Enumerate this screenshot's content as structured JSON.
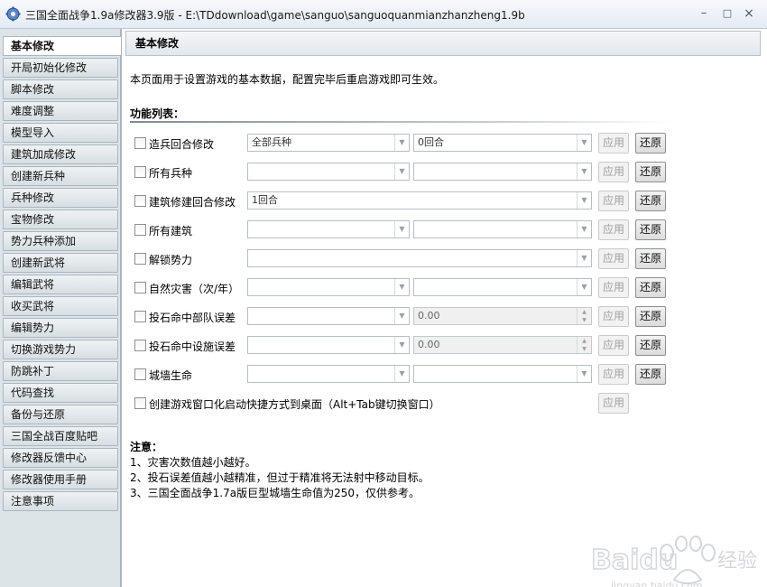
{
  "window": {
    "title": "三国全面战争1.9a修改器3.9版 - E:\\TDdownload\\game\\sanguo\\sanguoquanmianzhanzheng1.9b",
    "minimize": "–",
    "maximize": "□",
    "close": "×"
  },
  "sidebar": {
    "items": [
      {
        "label": "基本修改"
      },
      {
        "label": "开局初始化修改"
      },
      {
        "label": "脚本修改"
      },
      {
        "label": "难度调整"
      },
      {
        "label": "模型导入"
      },
      {
        "label": "建筑加成修改"
      },
      {
        "label": "创建新兵种"
      },
      {
        "label": "兵种修改"
      },
      {
        "label": "宝物修改"
      },
      {
        "label": "势力兵种添加"
      },
      {
        "label": "创建新武将"
      },
      {
        "label": "编辑武将"
      },
      {
        "label": "收买武将"
      },
      {
        "label": "编辑势力"
      },
      {
        "label": "切换游戏势力"
      },
      {
        "label": "防跳补丁"
      },
      {
        "label": "代码查找"
      },
      {
        "label": "备份与还原"
      },
      {
        "label": "三国全战百度贴吧"
      },
      {
        "label": "修改器反馈中心"
      },
      {
        "label": "修改器使用手册"
      },
      {
        "label": "注意事项"
      }
    ]
  },
  "main": {
    "header": "基本修改",
    "intro": "本页面用于设置游戏的基本数据，配置完毕后重启游戏即可生效。",
    "func_title": "功能列表：",
    "apply_label": "应用",
    "restore_label": "还原",
    "rows": [
      {
        "label": "造兵回合修改",
        "select1": "全部兵种",
        "select2": "0回合"
      },
      {
        "label": "所有兵种",
        "select1": "",
        "select2": ""
      },
      {
        "label": "建筑修建回合修改",
        "wide": "1回合"
      },
      {
        "label": "所有建筑",
        "select1": "",
        "select2": ""
      },
      {
        "label": "解锁势力",
        "wide": ""
      },
      {
        "label": "自然灾害（次/年）",
        "select1": "",
        "select2": ""
      },
      {
        "label": "投石命中部队误差",
        "select1": "",
        "spin": "0.00"
      },
      {
        "label": "投石命中设施误差",
        "select1": "",
        "spin": "0.00"
      },
      {
        "label": "城墙生命",
        "select1": "",
        "select2": ""
      }
    ],
    "shortcut_label": "创建游戏窗口化启动快捷方式到桌面（Alt+Tab键切换窗口）",
    "notes": {
      "title": "注意：",
      "lines": [
        "1、灾害次数值越小越好。",
        "2、投石误差值越小越精准，但过于精准将无法射中移动目标。",
        "3、三国全面战争1.7a版巨型城墙生命值为250，仅供参考。"
      ]
    }
  },
  "watermark": {
    "brand": "Baidu",
    "cn": "经验",
    "url": "jingyan.baidu.com"
  }
}
